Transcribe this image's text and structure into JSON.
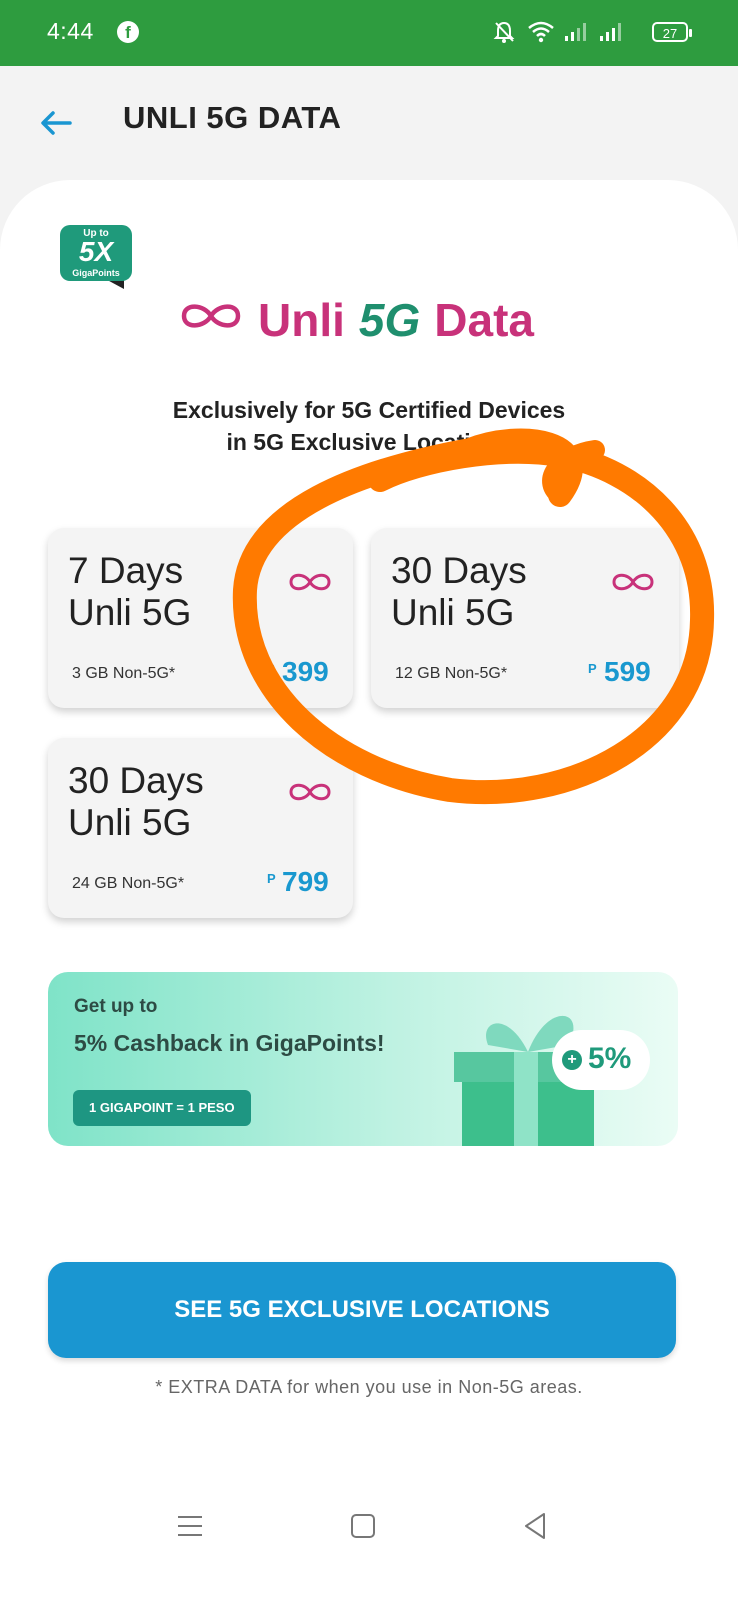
{
  "status": {
    "time": "4:44",
    "battery": "27"
  },
  "header": {
    "title": "UNLI 5G DATA"
  },
  "badge": {
    "up_to": "Up to",
    "multiplier": "5X",
    "label": "GigaPoints"
  },
  "brand": {
    "unli": "Unli",
    "five_g": "5G",
    "data": "Data"
  },
  "exclusive_text": {
    "line1": "Exclusively for 5G Certified Devices",
    "line2": "in 5G Exclusive Locations"
  },
  "plans": [
    {
      "title_line1": "7 Days",
      "title_line2": "Unli 5G",
      "sub": "3 GB Non-5G*",
      "currency": "P",
      "price": "399"
    },
    {
      "title_line1": "30 Days",
      "title_line2": "Unli 5G",
      "sub": "12 GB Non-5G*",
      "currency": "P",
      "price": "599"
    },
    {
      "title_line1": "30 Days",
      "title_line2": "Unli 5G",
      "sub": "24 GB Non-5G*",
      "currency": "P",
      "price": "799"
    }
  ],
  "promo": {
    "get": "Get up to",
    "headline": "5% Cashback in GigaPoints!",
    "chip": "1 GIGAPOINT = 1 PESO",
    "percent": "5%"
  },
  "cta": {
    "label": "SEE 5G EXCLUSIVE LOCATIONS"
  },
  "footnote": "* EXTRA DATA for when you use in Non-5G areas.",
  "colors": {
    "statusbar": "#2e9c3f",
    "brand_pink": "#c8327a",
    "brand_green": "#1f8f6e",
    "accent_blue": "#1a96d1",
    "annotation_orange": "#ff7a00"
  }
}
